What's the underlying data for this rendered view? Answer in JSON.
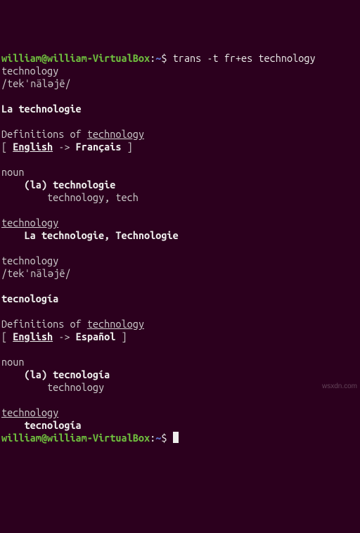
{
  "prompt1": {
    "user": "william@william-VirtualBox",
    "sep": ":",
    "path": "~",
    "dollar": "$",
    "command": " trans -t fr+es technology"
  },
  "echo_word": "technology",
  "phonetic": "/tekˈnäləjē/",
  "fr": {
    "main_translation": "La technologie",
    "definitions_prefix": "Definitions of ",
    "definitions_word": "technology",
    "bracket_open": "[ ",
    "src_lang": "English",
    "arrow": " -> ",
    "tgt_lang": "Français",
    "bracket_close": " ]",
    "pos": "noun",
    "sense1": "    (la) technologie",
    "sense1_back": "        technology, tech",
    "back_word": "technology",
    "variants": "    La technologie, Technologie"
  },
  "es": {
    "echo_word": "technology",
    "phonetic": "/tekˈnäləjē/",
    "main_translation": "tecnología",
    "definitions_prefix": "Definitions of ",
    "definitions_word": "technology",
    "bracket_open": "[ ",
    "src_lang": "English",
    "arrow": " -> ",
    "tgt_lang": "Español",
    "bracket_close": " ]",
    "pos": "noun",
    "sense1": "    (la) tecnología",
    "sense1_back": "        technology",
    "back_word": "technology",
    "variants": "    tecnología"
  },
  "prompt2": {
    "user": "william@william-VirtualBox",
    "sep": ":",
    "path": "~",
    "dollar": "$"
  },
  "watermark": "wsxdn.com"
}
